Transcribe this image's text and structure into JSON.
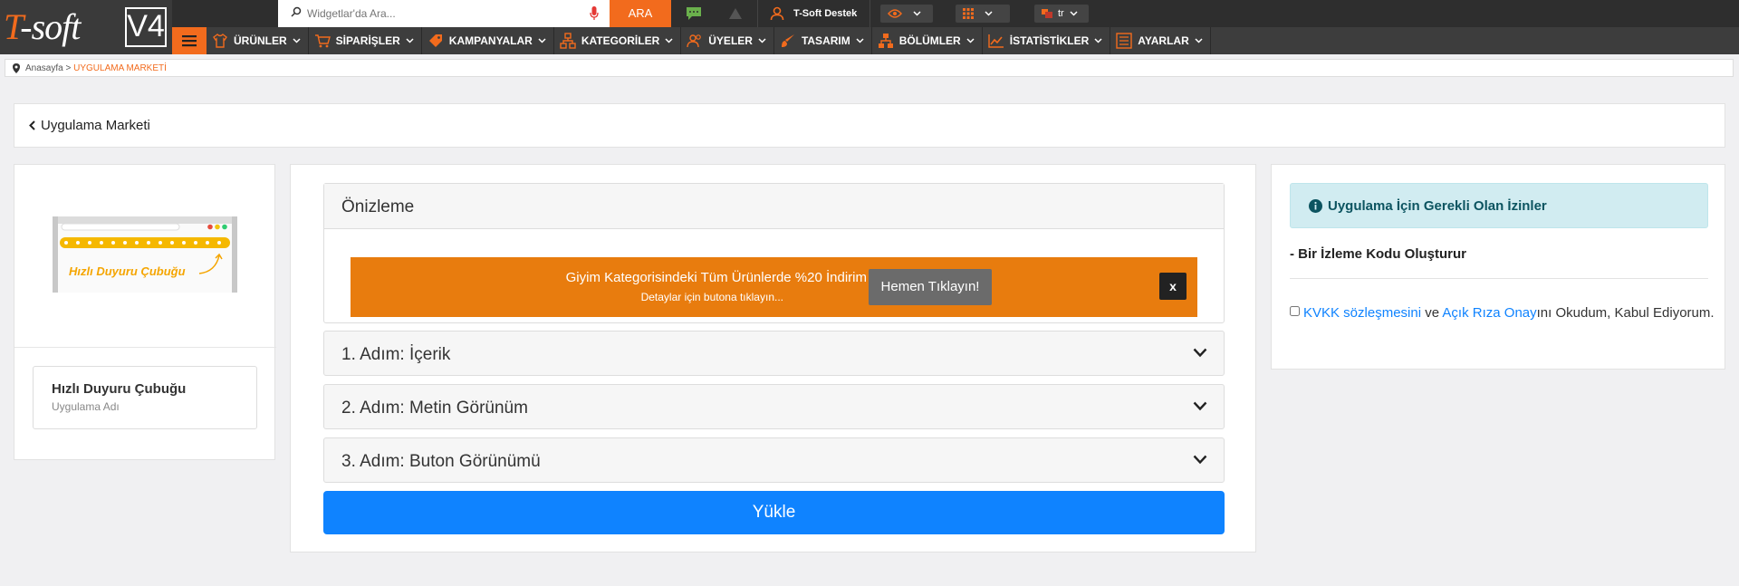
{
  "logo": {
    "brand": "T-soft",
    "version": "V4"
  },
  "topbar": {
    "search_placeholder": "Widgetlar'da Ara...",
    "search_button": "ARA",
    "support_label": "T-Soft Destek",
    "language": "tr"
  },
  "nav": {
    "items": [
      {
        "label": "ÜRÜNLER",
        "icon": "shirt-icon"
      },
      {
        "label": "SİPARİŞLER",
        "icon": "cart-icon"
      },
      {
        "label": "KAMPANYALAR",
        "icon": "tag-icon"
      },
      {
        "label": "KATEGORİLER",
        "icon": "sitemap-icon"
      },
      {
        "label": "ÜYELER",
        "icon": "users-icon"
      },
      {
        "label": "TASARIM",
        "icon": "brush-icon"
      },
      {
        "label": "BÖLÜMLER",
        "icon": "sections-icon"
      },
      {
        "label": "İSTATİSTİKLER",
        "icon": "chart-icon"
      },
      {
        "label": "AYARLAR",
        "icon": "settings-list-icon"
      }
    ]
  },
  "breadcrumb": {
    "home": "Anasayfa",
    "separator": ">",
    "current": "UYGULAMA MARKETİ"
  },
  "page": {
    "back_title": "Uygulama Marketi"
  },
  "app": {
    "thumbnail_caption": "Hızlı Duyuru Çubuğu",
    "name": "Hızlı Duyuru Çubuğu",
    "name_label": "Uygulama Adı"
  },
  "preview": {
    "title": "Önizleme",
    "announcement_text": "Giyim Kategorisindeki Tüm Ürünlerde %20 İndirim",
    "announcement_sub": "Detaylar için butona tıklayın...",
    "announcement_button": "Hemen Tıklayın!",
    "close_label": "x"
  },
  "steps": [
    {
      "label": "1. Adım: İçerik"
    },
    {
      "label": "2. Adım: Metin Görünüm"
    },
    {
      "label": "3. Adım: Buton Görünümü"
    }
  ],
  "upload_button": "Yükle",
  "permissions": {
    "title": "Uygulama İçin Gerekli Olan İzinler",
    "items": [
      "- Bir İzleme Kodu Oluşturur"
    ],
    "consent": {
      "link1": "KVKK sözleşmesini",
      "and": " ve ",
      "link2": "Açık Rıza Onay",
      "rest": "ını Okudum, Kabul Ediyorum."
    }
  },
  "colors": {
    "brand_orange": "#f26b1d",
    "announce_orange": "#e87c0e",
    "primary_blue": "#0f83ff",
    "info_bg": "#d1ecf1"
  }
}
